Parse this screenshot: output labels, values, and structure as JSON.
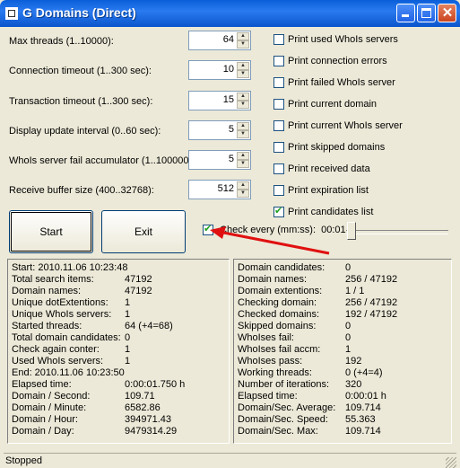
{
  "window": {
    "title": "G Domains (Direct)"
  },
  "settings": [
    {
      "label": "Max threads (1..10000):",
      "value": "64"
    },
    {
      "label": "Connection timeout (1..300 sec):",
      "value": "10"
    },
    {
      "label": "Transaction timeout (1..300 sec):",
      "value": "15"
    },
    {
      "label": "Display update interval (0..60 sec):",
      "value": "5"
    },
    {
      "label": "WhoIs server fail accumulator (1..100000):",
      "value": "5"
    },
    {
      "label": "Receive buffer size (400..32768):",
      "value": "512"
    }
  ],
  "options": [
    {
      "label": "Print used WhoIs servers",
      "checked": false
    },
    {
      "label": "Print connection errors",
      "checked": false
    },
    {
      "label": "Print failed WhoIs server",
      "checked": false
    },
    {
      "label": "Print current domain",
      "checked": false
    },
    {
      "label": "Print current WhoIs server",
      "checked": false
    },
    {
      "label": "Print skipped domains",
      "checked": false
    },
    {
      "label": "Print received data",
      "checked": false
    },
    {
      "label": "Print expiration list",
      "checked": false
    },
    {
      "label": "Print candidates list",
      "checked": true
    }
  ],
  "buttons": {
    "start": "Start",
    "exit": "Exit"
  },
  "check_every": {
    "label": "Check every (mm:ss):",
    "value": "00:01",
    "checked": true
  },
  "left_stats": [
    {
      "label": "Start: 2010.11.06 10:23:48",
      "value": ""
    },
    {
      "label": "Total search items:",
      "value": "47192"
    },
    {
      "label": "Domain names:",
      "value": "47192"
    },
    {
      "label": "Unique dotExtentions:",
      "value": "1"
    },
    {
      "label": "Unique WhoIs servers:",
      "value": "1"
    },
    {
      "label": "Started threads:",
      "value": "64 (+4=68)"
    },
    {
      "label": "Total domain candidates:",
      "value": "0"
    },
    {
      "label": "Check again conter:",
      "value": "1"
    },
    {
      "label": "Used WhoIs servers:",
      "value": "1"
    },
    {
      "label": "End: 2010.11.06 10:23:50",
      "value": ""
    },
    {
      "label": "Elapsed time:",
      "value": "0:00:01.750 h"
    },
    {
      "label": "Domain / Second:",
      "value": "109.71"
    },
    {
      "label": "Domain / Minute:",
      "value": "6582.86"
    },
    {
      "label": "Domain / Hour:",
      "value": "394971.43"
    },
    {
      "label": "Domain / Day:",
      "value": "9479314.29"
    }
  ],
  "right_stats": [
    {
      "label": "Domain candidates:",
      "value": "0"
    },
    {
      "label": "Domain names:",
      "value": "256 / 47192"
    },
    {
      "label": "Domain extentions:",
      "value": "1 / 1"
    },
    {
      "label": "Checking domain:",
      "value": "256 / 47192"
    },
    {
      "label": "Checked domains:",
      "value": "192 / 47192"
    },
    {
      "label": "Skipped domains:",
      "value": "0"
    },
    {
      "label": "WhoIses fail:",
      "value": "0"
    },
    {
      "label": "WhoIses fail accm:",
      "value": "1"
    },
    {
      "label": "WhoIses pass:",
      "value": "192"
    },
    {
      "label": "Working threads:",
      "value": "0 (+4=4)"
    },
    {
      "label": "Number of iterations:",
      "value": "320"
    },
    {
      "label": "Elapsed time:",
      "value": "0:00:01 h"
    },
    {
      "label": "Domain/Sec. Average:",
      "value": "109.714"
    },
    {
      "label": "Domain/Sec. Speed:",
      "value": "55.363"
    },
    {
      "label": "Domain/Sec. Max:",
      "value": "109.714"
    }
  ],
  "status_bar": {
    "text": "Stopped"
  },
  "colors": {
    "titlebar": "#0a5fd8",
    "arrow": "#e01010",
    "face": "#ece9d8"
  }
}
